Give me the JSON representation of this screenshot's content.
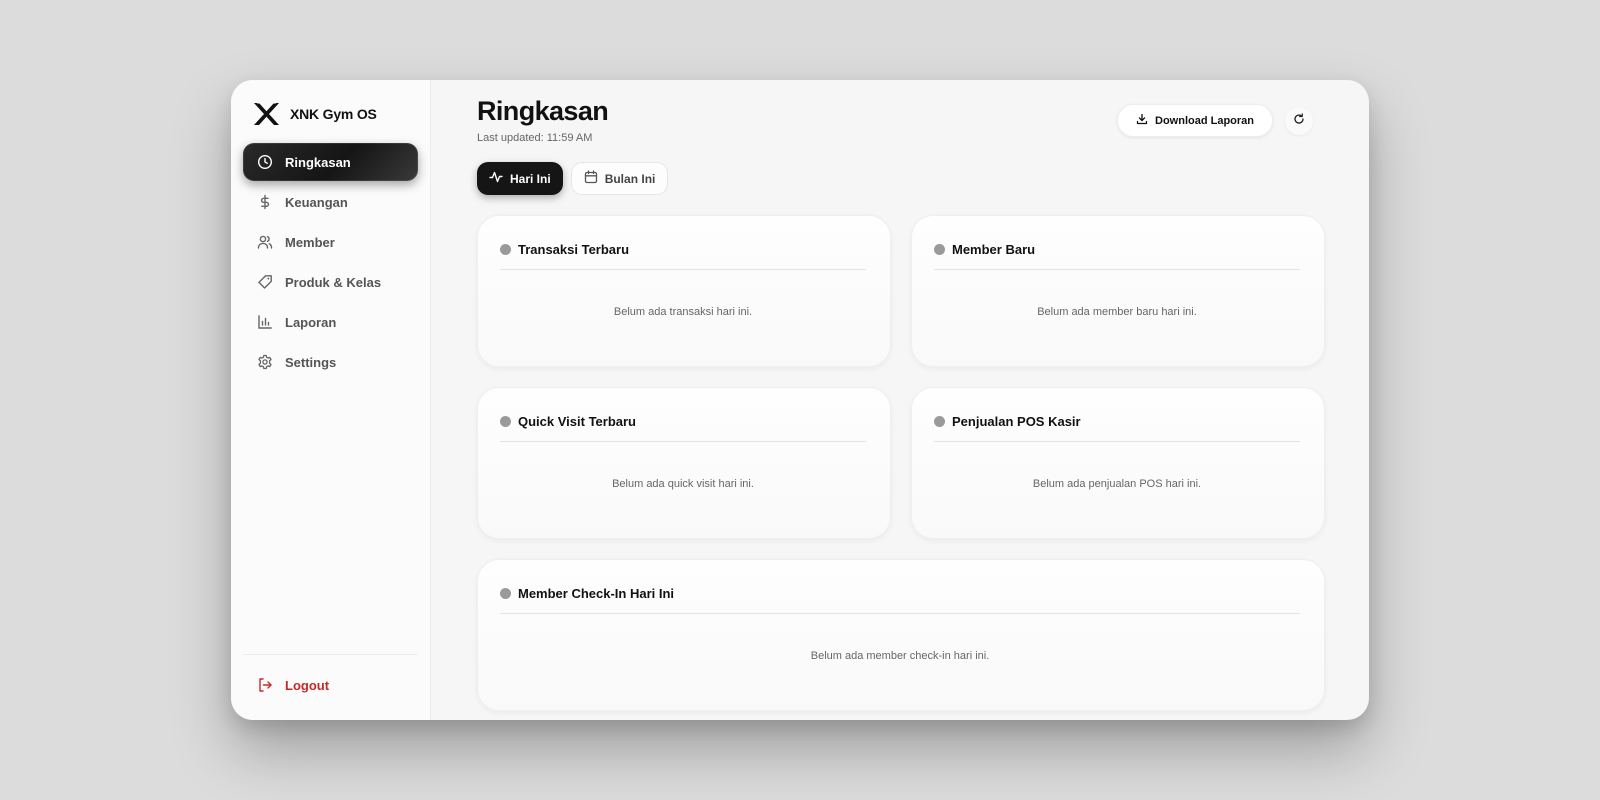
{
  "app": {
    "name": "XNK Gym OS"
  },
  "sidebar": {
    "items": [
      {
        "label": "Ringkasan",
        "icon": "clock-icon",
        "active": true
      },
      {
        "label": "Keuangan",
        "icon": "dollar-icon",
        "active": false
      },
      {
        "label": "Member",
        "icon": "users-icon",
        "active": false
      },
      {
        "label": "Produk & Kelas",
        "icon": "tag-icon",
        "active": false
      },
      {
        "label": "Laporan",
        "icon": "bar-chart-icon",
        "active": false
      },
      {
        "label": "Settings",
        "icon": "gear-icon",
        "active": false
      }
    ],
    "logout_label": "Logout"
  },
  "header": {
    "title": "Ringkasan",
    "last_updated": "Last updated: 11:59 AM",
    "download_label": "Download Laporan"
  },
  "tabs": [
    {
      "label": "Hari Ini",
      "active": true
    },
    {
      "label": "Bulan Ini",
      "active": false
    }
  ],
  "cards": [
    {
      "title": "Transaksi Terbaru",
      "empty": "Belum ada transaksi hari ini."
    },
    {
      "title": "Member Baru",
      "empty": "Belum ada member baru hari ini."
    },
    {
      "title": "Quick Visit Terbaru",
      "empty": "Belum ada quick visit hari ini."
    },
    {
      "title": "Penjualan POS Kasir",
      "empty": "Belum ada penjualan POS hari ini."
    },
    {
      "title": "Member Check-In Hari Ini",
      "empty": "Belum ada member check-in hari ini."
    }
  ],
  "colors": {
    "accent_dark": "#151515",
    "logout_red": "#c62828",
    "status_dot": "#9a9a9a"
  }
}
